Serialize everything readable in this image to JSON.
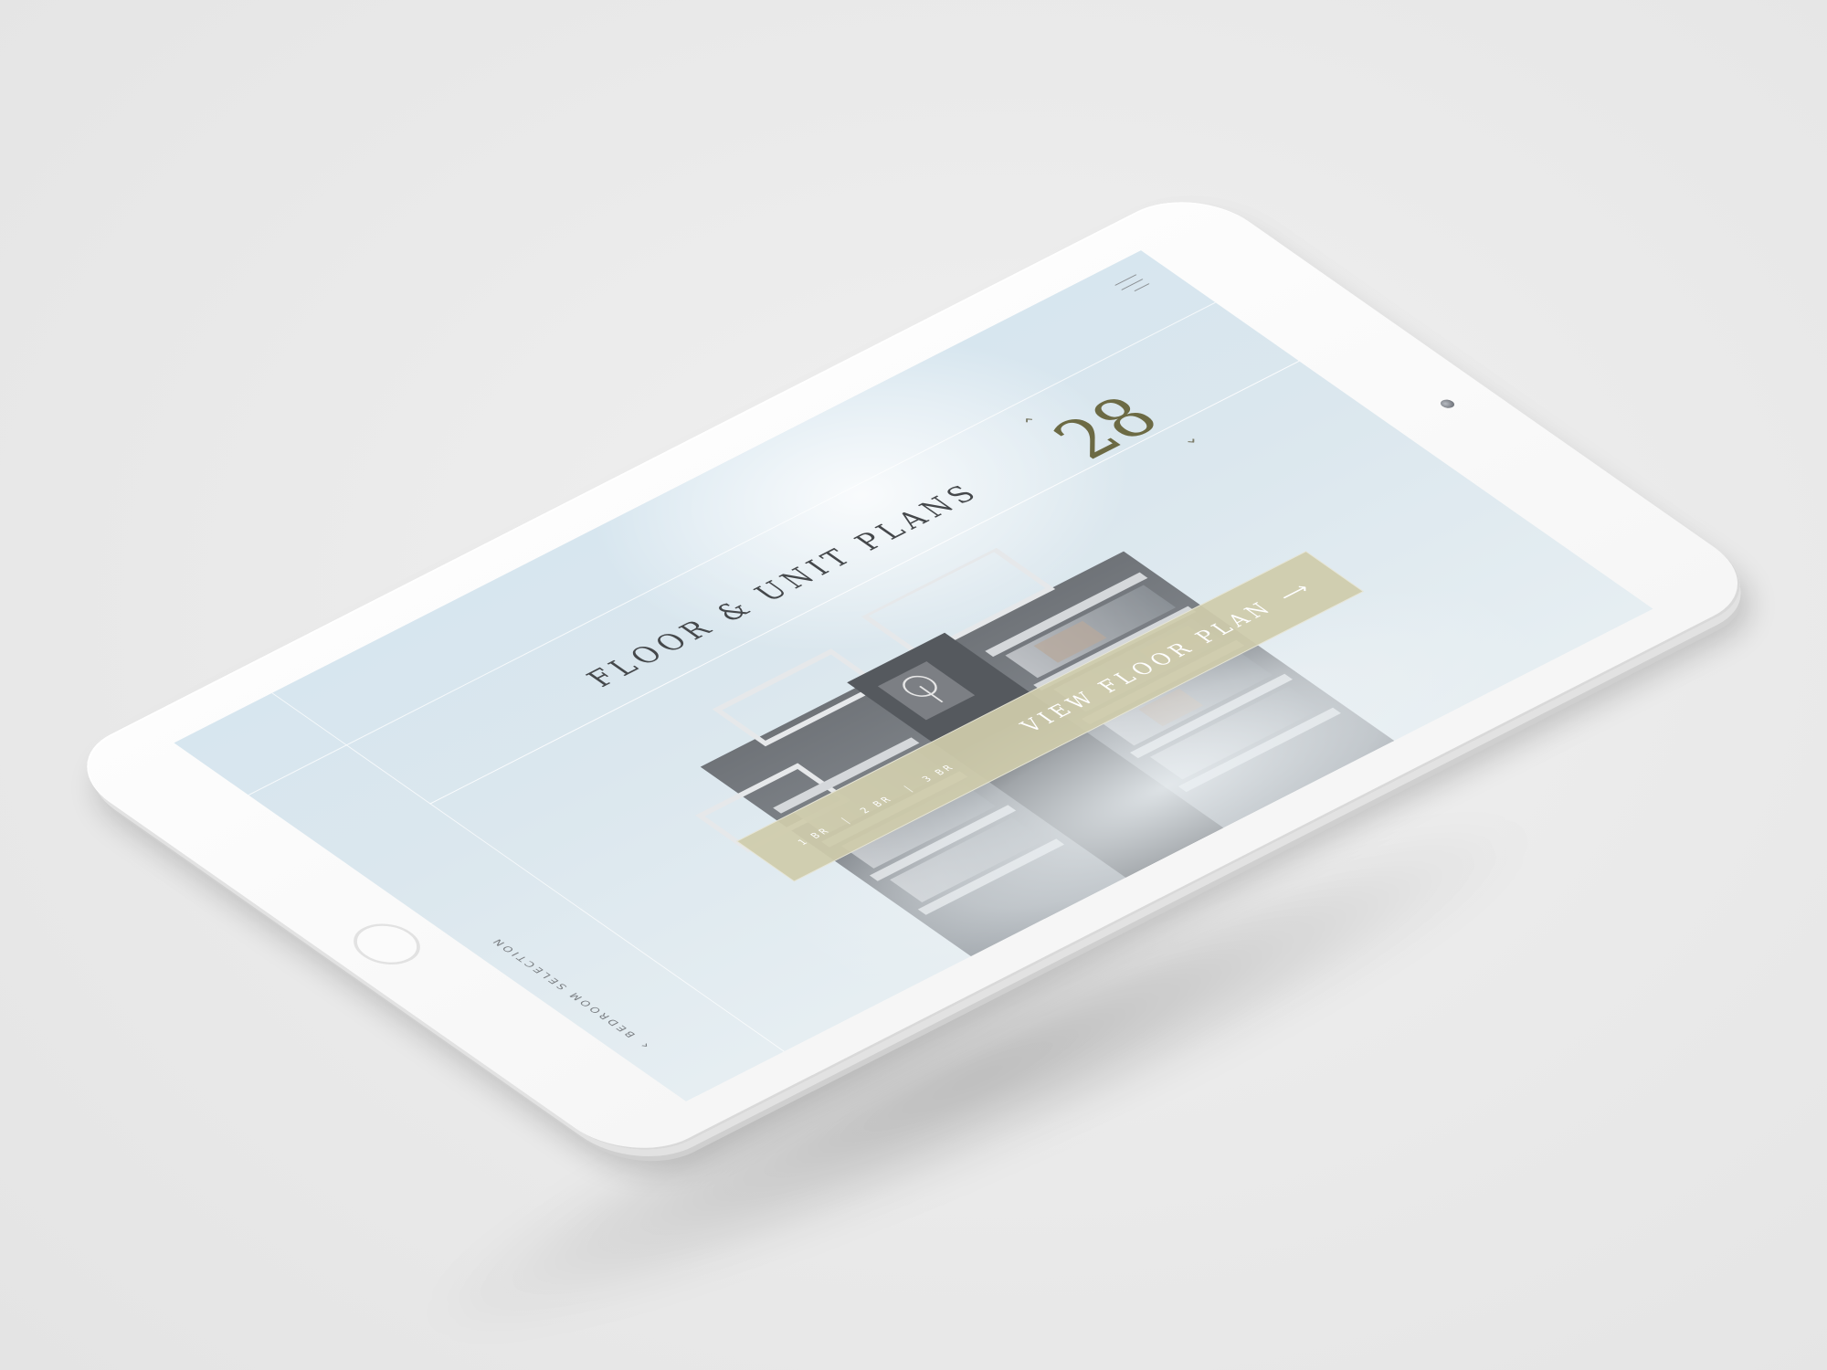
{
  "app": {
    "page_title": "FLOOR & UNIT PLANS",
    "menu_icon": "hamburger-menu-icon"
  },
  "navigation": {
    "back_label": "BEDROOM SELECTION",
    "back_icon": "chevron-left-icon"
  },
  "floor_selector": {
    "current_floor": "28",
    "up_icon": "chevron-up-icon",
    "down_icon": "chevron-down-icon"
  },
  "unit_bar": {
    "bedroom_options": [
      "1 BR",
      "2 BR",
      "3 BR"
    ],
    "cta_label": "VIEW FLOOR PLAN",
    "cta_icon": "arrow-right-icon"
  },
  "colors": {
    "accent_gold": "#6c6a44",
    "cta_bar": "#cfcbab",
    "sky": "#d7e6ef",
    "device_white": "#fdfdfd"
  }
}
